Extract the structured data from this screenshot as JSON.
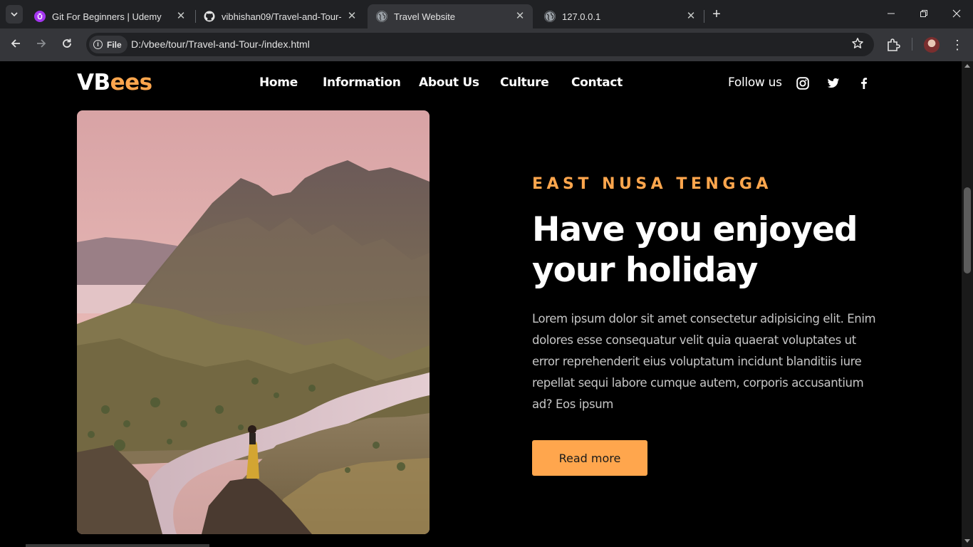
{
  "browser": {
    "tabs": [
      {
        "title": "Git For Beginners | Udemy",
        "icon": "udemy-icon",
        "active": false
      },
      {
        "title": "vibhishan09/Travel-and-Tour-",
        "icon": "github-icon",
        "active": false
      },
      {
        "title": "Travel Website",
        "icon": "globe-icon",
        "active": true
      },
      {
        "title": "127.0.0.1",
        "icon": "globe-icon",
        "active": false
      }
    ],
    "address": {
      "chip_label": "File",
      "url": "D:/vbee/tour/Travel-and-Tour-/index.html"
    }
  },
  "site": {
    "logo_primary": "VB",
    "logo_accent": "ees",
    "nav": [
      "Home",
      "Information",
      "About Us",
      "Culture",
      "Contact"
    ],
    "follow_label": "Follow us",
    "social_icons": [
      "instagram-icon",
      "twitter-icon",
      "facebook-icon"
    ]
  },
  "hero": {
    "kicker": "EAST NUSA TENGGA",
    "headline_line1": "Have you enjoyed",
    "headline_line2": "your holiday",
    "body": "Lorem ipsum dolor sit amet consectetur adipisicing elit. Enim dolores esse consequatur velit quia quaerat voluptates ut error reprehenderit eius voluptatum incidunt blanditiis iure repellat sequi labore cumque autem, corporis accusantium ad? Eos ipsum",
    "cta_label": "Read more"
  },
  "colors": {
    "accent": "#ffa64d",
    "background": "#000000",
    "chrome_dark": "#202124",
    "chrome_toolbar": "#35363a"
  }
}
